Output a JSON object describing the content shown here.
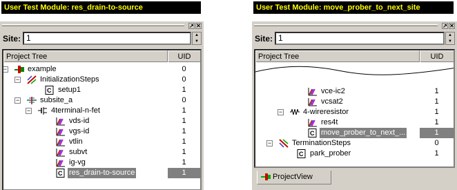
{
  "left": {
    "title": "User Test Module: res_drain-to-source",
    "site_label": "Site:",
    "site_value": "1",
    "col_tree": "Project Tree",
    "col_uid": "UID",
    "rows": [
      {
        "label": "example",
        "uid": "0",
        "icon": "project-icon"
      },
      {
        "label": "InitializationSteps",
        "uid": "0",
        "icon": "initialization-steps-icon"
      },
      {
        "label": "setup1",
        "uid": "1",
        "icon": "code-module-icon"
      },
      {
        "label": "subsite_a",
        "uid": "0",
        "icon": "subsite-icon"
      },
      {
        "label": "4terminal-n-fet",
        "uid": "1",
        "icon": "fet-device-icon"
      },
      {
        "label": "vds-id",
        "uid": "1",
        "icon": "curve-test-icon"
      },
      {
        "label": "vgs-id",
        "uid": "1",
        "icon": "curve-test-icon"
      },
      {
        "label": "vtlin",
        "uid": "1",
        "icon": "curve-test-icon"
      },
      {
        "label": "subvt",
        "uid": "1",
        "icon": "curve-test-icon"
      },
      {
        "label": "ig-vg",
        "uid": "1",
        "icon": "curve-test-icon"
      },
      {
        "label": "res_drain-to-source",
        "uid": "1",
        "icon": "code-module-icon"
      }
    ]
  },
  "right": {
    "title": "User Test Module: move_prober_to_next_site",
    "site_label": "Site:",
    "site_value": "1",
    "col_tree": "Project Tree",
    "col_uid": "UID",
    "rows": [
      {
        "label": "vce-ic2",
        "uid": "1",
        "icon": "curve-test-icon"
      },
      {
        "label": "vcsat2",
        "uid": "1",
        "icon": "curve-test-icon"
      },
      {
        "label": "4-wireresistor",
        "uid": "1",
        "icon": "resistor-device-icon"
      },
      {
        "label": "res4t",
        "uid": "1",
        "icon": "curve-test-icon"
      },
      {
        "label": "move_prober_to_next_...",
        "uid": "1",
        "icon": "code-module-icon"
      },
      {
        "label": "TerminationSteps",
        "uid": "0",
        "icon": "termination-steps-icon"
      },
      {
        "label": "park_prober",
        "uid": "1",
        "icon": "code-module-icon"
      }
    ],
    "tab_label": "ProjectView"
  }
}
